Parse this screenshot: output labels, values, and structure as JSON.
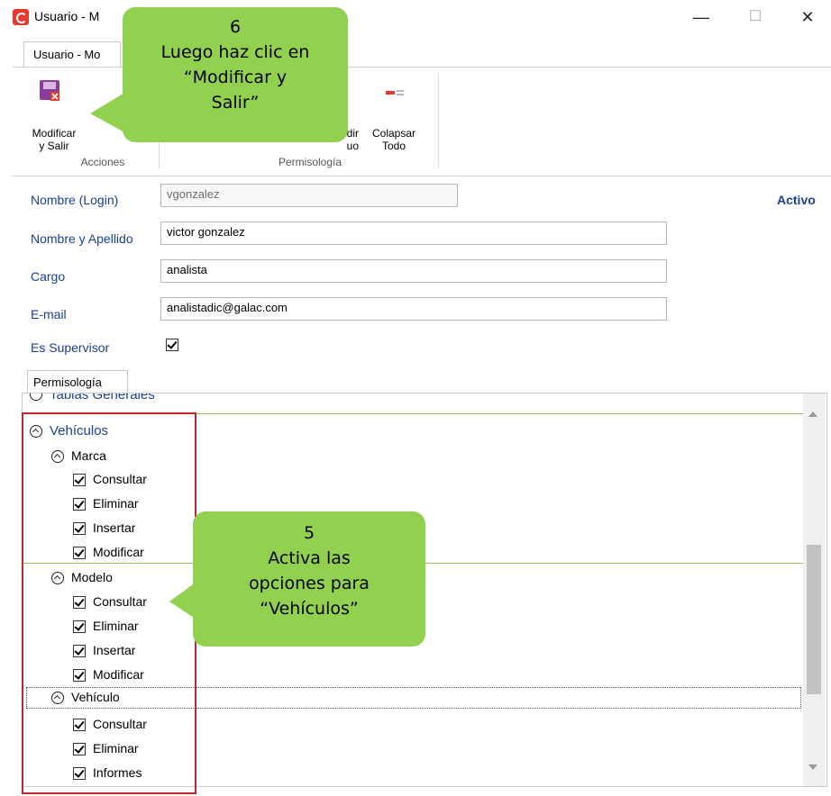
{
  "window": {
    "title": "Usuario - M",
    "tab_label": "Usuario - Mo",
    "minimize": "—",
    "maximize": "☐",
    "close": "✕"
  },
  "ribbon": {
    "modificar_salir": "Modificar\ny Salir",
    "acciones_group": "Acciones",
    "expandir_partial": "dir\nuo",
    "colapsar": "Colapsar\nTodo",
    "permisologia_group": "Permisología"
  },
  "form": {
    "status": "Activo",
    "login_label": "Nombre (Login)",
    "login_value": "vgonzalez",
    "nombre_label": "Nombre y Apellido",
    "nombre_value": "victor gonzalez",
    "cargo_label": "Cargo",
    "cargo_value": "analista",
    "email_label": "E-mail",
    "email_value": "analistadic@galac.com",
    "supervisor_label": "Es Supervisor",
    "supervisor_checked": true
  },
  "permisos_tab": "Permisología",
  "tree": {
    "top_partial": "Tablas Generales",
    "root": "Vehículos",
    "groups": [
      {
        "name": "Marca",
        "items": [
          "Consultar",
          "Eliminar",
          "Insertar",
          "Modificar"
        ]
      },
      {
        "name": "Modelo",
        "items": [
          "Consultar",
          "Eliminar",
          "Insertar",
          "Modificar"
        ]
      },
      {
        "name": "Vehículo",
        "items": [
          "Consultar",
          "Eliminar",
          "Informes"
        ]
      }
    ]
  },
  "callouts": {
    "step6_num": "6",
    "step6_text": "Luego haz clic en\n“Modificar y\nSalir”",
    "step5_num": "5",
    "step5_text": "Activa las\nopciones para\n“Vehículos”"
  },
  "colors": {
    "accent": "#1b3e9e",
    "callout": "#92d050",
    "highlight_box": "#c0282d"
  }
}
